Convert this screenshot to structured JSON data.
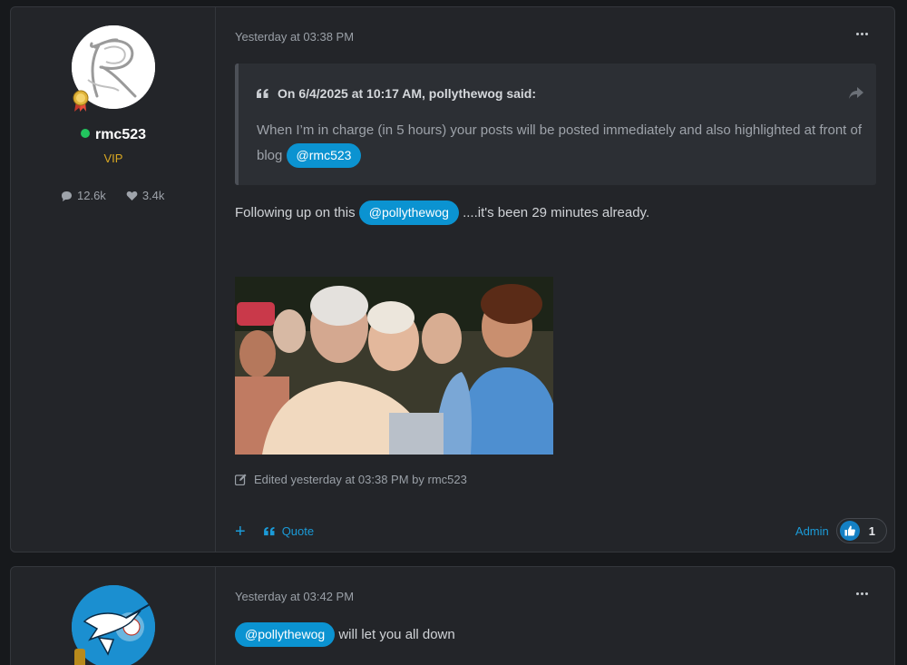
{
  "posts": [
    {
      "author": {
        "name": "rmc523",
        "role": "VIP",
        "posts_count": "12.6k",
        "likes_count": "3.4k",
        "online": true
      },
      "timestamp": "Yesterday at 03:38 PM",
      "quote": {
        "header": "On 6/4/2025 at 10:17 AM, pollythewog said:",
        "text": "When I’m in charge (in 5 hours) your posts will be posted immediately and also highlighted at front of blog",
        "mention": "@rmc523"
      },
      "body": {
        "before": "Following up on this",
        "mention": "@pollythewog",
        "after": "....it's been 29 minutes already."
      },
      "edited": "Edited yesterday at 03:38 PM by rmc523",
      "actions": {
        "plus": "+",
        "quote_label": "Quote"
      },
      "reactions": {
        "user": "Admin",
        "count": "1"
      }
    },
    {
      "timestamp": "Yesterday at 03:42 PM",
      "body": {
        "mention": "@pollythewog",
        "after": "will let you all down"
      }
    }
  ],
  "colors": {
    "accent": "#0b93d1",
    "link": "#1b9bd8",
    "vip": "#d8a722",
    "online": "#22c55e"
  },
  "icons": [
    "ellipsis-icon",
    "quote-icon",
    "share-icon",
    "comment-icon",
    "heart-icon",
    "edit-icon",
    "plus-icon",
    "thumbs-up-icon"
  ]
}
